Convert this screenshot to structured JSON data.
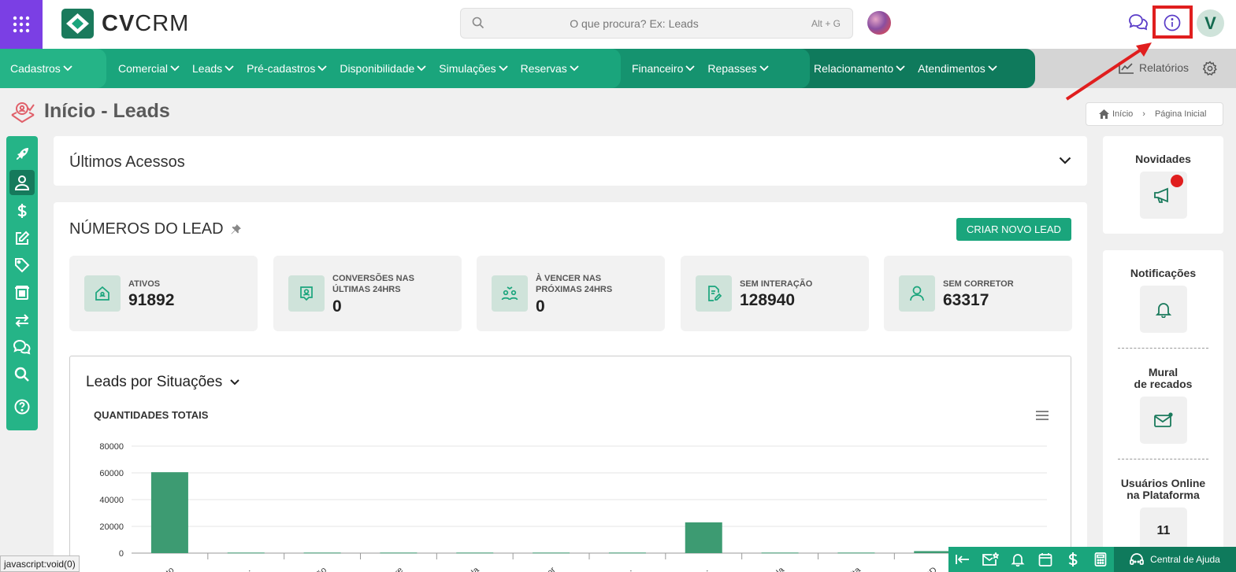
{
  "header": {
    "logo_bold": "CV",
    "logo_light": "CRM",
    "search_placeholder": "O que procura? Ex: Leads",
    "search_shortcut": "Alt + G",
    "avatar_initial": "V"
  },
  "nav": {
    "cadastros": "Cadastros",
    "group1": [
      "Comercial",
      "Leads",
      "Pré-cadastros",
      "Disponibilidade",
      "Simulações",
      "Reservas"
    ],
    "group2": [
      "Financeiro",
      "Repasses"
    ],
    "group3": [
      "Relacionamento",
      "Atendimentos"
    ],
    "relatorios": "Relatórios"
  },
  "page": {
    "title": "Início - Leads",
    "breadcrumb_home": "Início",
    "breadcrumb_current": "Página Inicial"
  },
  "ultimos": {
    "title": "Últimos Acessos"
  },
  "numeros": {
    "title": "NÚMEROS DO LEAD",
    "create_button": "CRIAR NOVO LEAD",
    "stats": [
      {
        "label1": "ATIVOS",
        "label2": "",
        "value": "91892",
        "icon": "home-icon"
      },
      {
        "label1": "CONVERSÕES NAS",
        "label2": "ÚLTIMAS 24HRS",
        "value": "0",
        "icon": "badge-user-icon"
      },
      {
        "label1": "À VENCER NAS",
        "label2": "PRÓXIMAS 24HRS",
        "value": "0",
        "icon": "users-icon"
      },
      {
        "label1": "SEM INTERAÇÃO",
        "label2": "",
        "value": "128940",
        "icon": "document-edit-icon"
      },
      {
        "label1": "SEM CORRETOR",
        "label2": "",
        "value": "63317",
        "icon": "user-icon"
      }
    ]
  },
  "chart": {
    "title": "Leads por Situações",
    "subtitle": "QUANTIDADES TOTAIS"
  },
  "chart_data": {
    "type": "bar",
    "title": "QUANTIDADES TOTAIS",
    "categories": [
      "...tato",
      "At...",
      "...ção",
      "...pre",
      "...dada",
      "...stor",
      "...to...",
      "...ne...",
      "...uida",
      "...isita",
      "... RD",
      "...nda"
    ],
    "values": [
      60500,
      400,
      400,
      400,
      400,
      400,
      400,
      23000,
      400,
      400,
      1500,
      400
    ],
    "yticks": [
      "0",
      "20000",
      "40000",
      "60000",
      "80000"
    ],
    "ylim": [
      0,
      80000
    ],
    "color": "#3d9b72"
  },
  "right_panel": {
    "novidades": "Novidades",
    "notificacoes": "Notificações",
    "mural_line1": "Mural",
    "mural_line2": "de recados",
    "usuarios_line1": "Usuários Online",
    "usuarios_line2": "na Plataforma",
    "usuarios_count": "11"
  },
  "status_bar": "javascript:void(0)",
  "bottom_bar": {
    "help": "Central de Ajuda"
  },
  "colors": {
    "primary": "#1aa57c",
    "dark": "#0f7a5c",
    "apps": "#7b3fe4",
    "highlight": "#e01e1e"
  }
}
